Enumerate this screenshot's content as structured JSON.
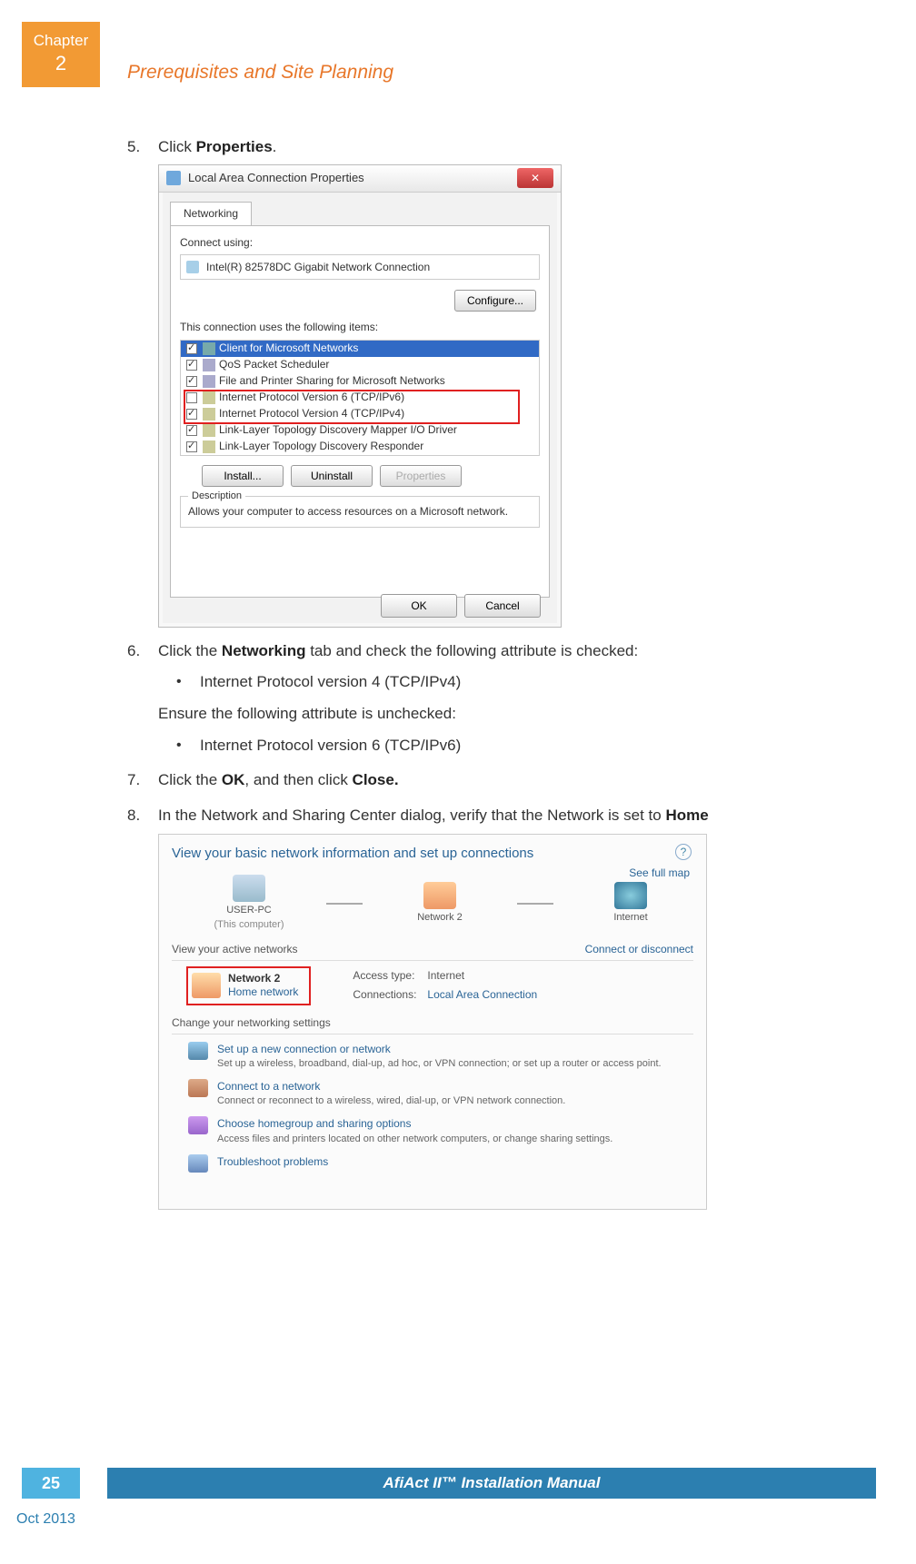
{
  "chapter": {
    "label": "Chapter",
    "number": "2"
  },
  "section_title": "Prerequisites and Site Planning",
  "steps": {
    "s5": {
      "n": "5.",
      "pre": "Click ",
      "bold": "Properties",
      "post": "."
    },
    "s6": {
      "n": "6.",
      "pre": "Click the ",
      "bold": "Networking",
      "post": " tab and check the following attribute is checked:",
      "bullet_checked": "Internet Protocol version 4 (TCP/IPv4)",
      "mid": "Ensure the following attribute is unchecked:",
      "bullet_unchecked": "Internet Protocol version 6 (TCP/IPv6)"
    },
    "s7": {
      "n": "7.",
      "pre": "Click the ",
      "bold1": "OK",
      "mid": ", and then click ",
      "bold2": "Close."
    },
    "s8": {
      "n": "8.",
      "pre": "In the Network and Sharing Center dialog, verify that the Network is set to ",
      "bold": "Home"
    }
  },
  "dialog1": {
    "title": "Local Area Connection Properties",
    "close": "✕",
    "tab": "Networking",
    "connect_using": "Connect using:",
    "adapter": "Intel(R) 82578DC Gigabit Network Connection",
    "configure_btn": "Configure...",
    "items_label": "This connection uses the following items:",
    "items": [
      {
        "checked": true,
        "sel": true,
        "label": "Client for Microsoft Networks"
      },
      {
        "checked": true,
        "sel": false,
        "label": "QoS Packet Scheduler"
      },
      {
        "checked": true,
        "sel": false,
        "label": "File and Printer Sharing for Microsoft Networks"
      },
      {
        "checked": false,
        "sel": false,
        "label": "Internet Protocol Version 6 (TCP/IPv6)"
      },
      {
        "checked": true,
        "sel": false,
        "label": "Internet Protocol Version 4 (TCP/IPv4)"
      },
      {
        "checked": true,
        "sel": false,
        "label": "Link-Layer Topology Discovery Mapper I/O Driver"
      },
      {
        "checked": true,
        "sel": false,
        "label": "Link-Layer Topology Discovery Responder"
      }
    ],
    "install_btn": "Install...",
    "uninstall_btn": "Uninstall",
    "properties_btn": "Properties",
    "desc_legend": "Description",
    "desc_text": "Allows your computer to access resources on a Microsoft network.",
    "ok_btn": "OK",
    "cancel_btn": "Cancel"
  },
  "dialog2": {
    "title": "View your basic network information and set up connections",
    "help": "?",
    "see_full_map": "See full map",
    "nodes": {
      "pc": "USER-PC",
      "pc_sub": "(This computer)",
      "net": "Network  2",
      "inet": "Internet"
    },
    "active_hd": "View your active networks",
    "connect_disconnect": "Connect or disconnect",
    "network_name": "Network  2",
    "network_type": "Home network",
    "access_type_lbl": "Access type:",
    "access_type_val": "Internet",
    "connections_lbl": "Connections:",
    "connections_val": "Local Area Connection",
    "change_hd": "Change your networking settings",
    "settings": [
      {
        "link": "Set up a new connection or network",
        "desc": "Set up a wireless, broadband, dial-up, ad hoc, or VPN connection; or set up a router or access point."
      },
      {
        "link": "Connect to a network",
        "desc": "Connect or reconnect to a wireless, wired, dial-up, or VPN network connection."
      },
      {
        "link": "Choose homegroup and sharing options",
        "desc": "Access files and printers located on other network computers, or change sharing settings."
      },
      {
        "link": "Troubleshoot problems",
        "desc": ""
      }
    ]
  },
  "footer": {
    "page_number": "25",
    "manual_title": "AfiAct II™ Installation Manual",
    "date": "Oct 2013"
  }
}
